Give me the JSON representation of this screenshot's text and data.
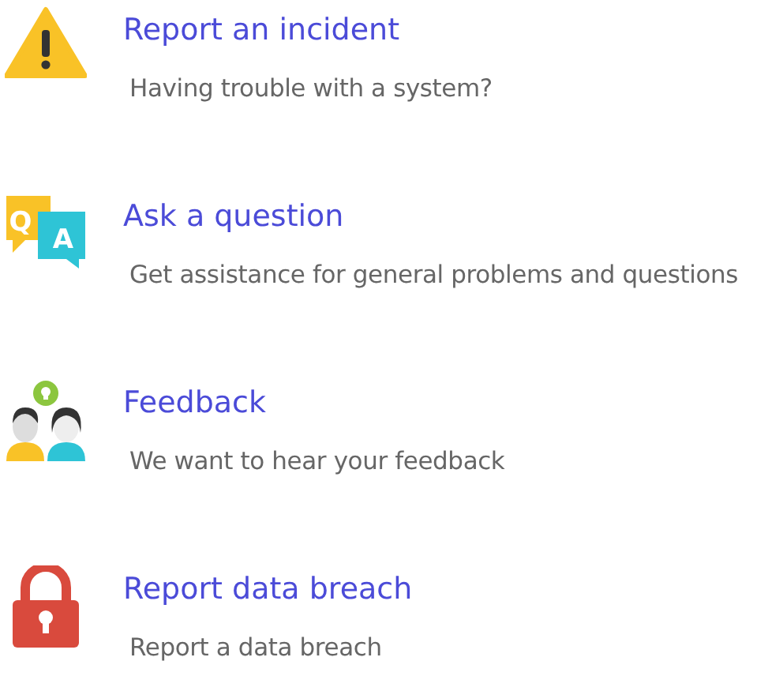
{
  "options": [
    {
      "kind": "warning",
      "title": "Report an incident",
      "description": "Having trouble with a system?"
    },
    {
      "kind": "qa",
      "icon_letters": [
        "Q",
        "A"
      ],
      "title": "Ask a question",
      "description": "Get assistance for general problems and questions"
    },
    {
      "kind": "people",
      "title": "Feedback",
      "description": "We want to hear your feedback"
    },
    {
      "kind": "lock",
      "title": "Report data breach",
      "description": "Report a data breach"
    }
  ]
}
